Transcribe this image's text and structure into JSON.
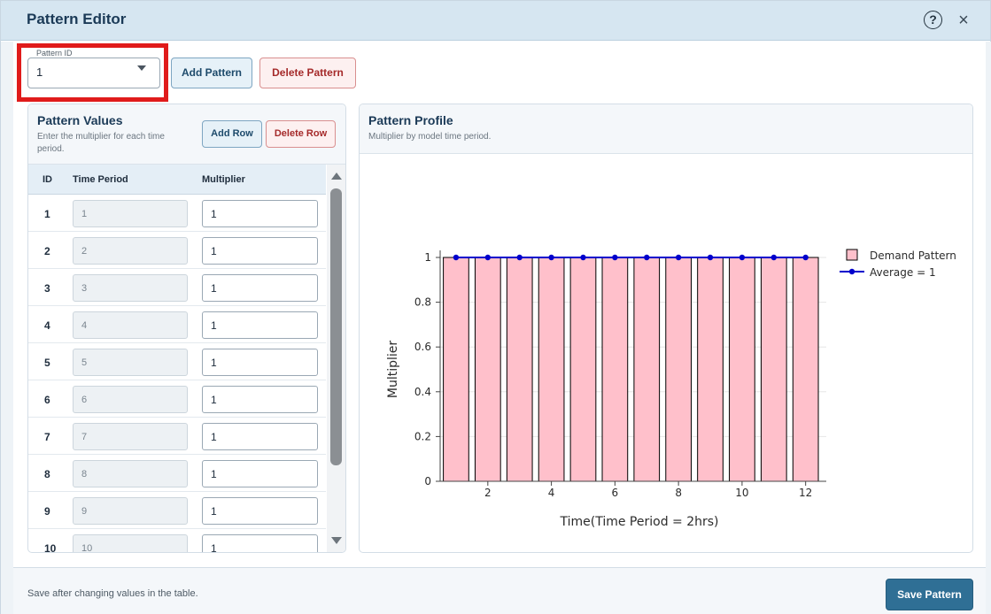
{
  "modal": {
    "title": "Pattern Editor",
    "help_icon": "?",
    "close_icon": "×"
  },
  "pattern_id": {
    "legend": "Pattern ID",
    "value": "1"
  },
  "toolbar": {
    "add_pattern": "Add Pattern",
    "delete_pattern": "Delete Pattern"
  },
  "values_panel": {
    "title": "Pattern Values",
    "subtitle": "Enter the multiplier for each time period.",
    "add_row": "Add Row",
    "delete_row": "Delete Row",
    "columns": [
      "ID",
      "Time Period",
      "Multiplier"
    ],
    "rows": [
      {
        "id": "1",
        "period": "1",
        "multiplier": "1"
      },
      {
        "id": "2",
        "period": "2",
        "multiplier": "1"
      },
      {
        "id": "3",
        "period": "3",
        "multiplier": "1"
      },
      {
        "id": "4",
        "period": "4",
        "multiplier": "1"
      },
      {
        "id": "5",
        "period": "5",
        "multiplier": "1"
      },
      {
        "id": "6",
        "period": "6",
        "multiplier": "1"
      },
      {
        "id": "7",
        "period": "7",
        "multiplier": "1"
      },
      {
        "id": "8",
        "period": "8",
        "multiplier": "1"
      },
      {
        "id": "9",
        "period": "9",
        "multiplier": "1"
      },
      {
        "id": "10",
        "period": "10",
        "multiplier": "1"
      }
    ]
  },
  "profile_panel": {
    "title": "Pattern Profile",
    "subtitle": "Multiplier by model time period."
  },
  "chart_data": {
    "type": "bar",
    "title": "",
    "xlabel": "Time(Time Period = 2hrs)",
    "ylabel": "Multiplier",
    "x": [
      1,
      2,
      3,
      4,
      5,
      6,
      7,
      8,
      9,
      10,
      11,
      12
    ],
    "x_ticks": [
      "2",
      "4",
      "6",
      "8",
      "10",
      "12"
    ],
    "y_ticks": [
      "0",
      "0.2",
      "0.4",
      "0.6",
      "0.8",
      "1"
    ],
    "ylim": [
      0,
      1
    ],
    "grid": true,
    "legend_position": "top-right",
    "series": [
      {
        "name": "Demand Pattern",
        "kind": "bar",
        "values": [
          1,
          1,
          1,
          1,
          1,
          1,
          1,
          1,
          1,
          1,
          1,
          1
        ],
        "color": "#ffc0cb",
        "edge": "#000000"
      },
      {
        "name": "Average = 1",
        "kind": "line",
        "values": [
          1,
          1,
          1,
          1,
          1,
          1,
          1,
          1,
          1,
          1,
          1,
          1
        ],
        "color": "#0000cc"
      }
    ]
  },
  "footer": {
    "note": "Save after changing values in the table.",
    "save": "Save Pattern"
  },
  "colors": {
    "header_bg": "#d6e6f1",
    "highlight": "#e01b1b",
    "primary": "#2f6f95",
    "danger": "#a52a2a"
  }
}
